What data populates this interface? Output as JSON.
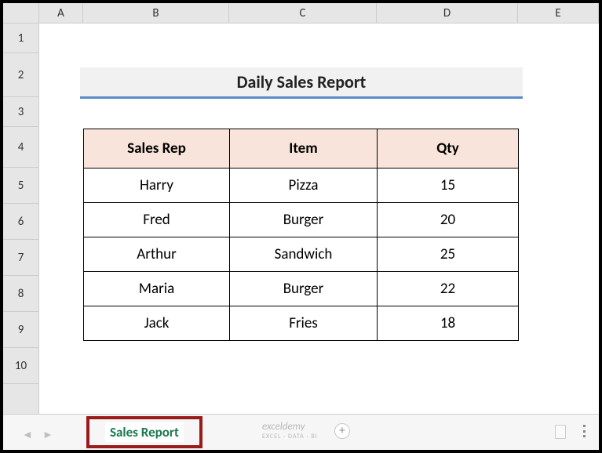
{
  "columns": {
    "A": "A",
    "B": "B",
    "C": "C",
    "D": "D",
    "E": "E"
  },
  "rows": {
    "r1": "1",
    "r2": "2",
    "r3": "3",
    "r4": "4",
    "r5": "5",
    "r6": "6",
    "r7": "7",
    "r8": "8",
    "r9": "9",
    "r10": "10"
  },
  "title": "Daily Sales Report",
  "headers": {
    "rep": "Sales Rep",
    "item": "Item",
    "qty": "Qty"
  },
  "data": [
    {
      "rep": "Harry",
      "item": "Pizza",
      "qty": "15"
    },
    {
      "rep": "Fred",
      "item": "Burger",
      "qty": "20"
    },
    {
      "rep": "Arthur",
      "item": "Sandwich",
      "qty": "25"
    },
    {
      "rep": "Maria",
      "item": "Burger",
      "qty": "22"
    },
    {
      "rep": "Jack",
      "item": "Fries",
      "qty": "18"
    }
  ],
  "tab": {
    "name": "Sales Report"
  },
  "watermark": {
    "main": "exceldemy",
    "sub": "EXCEL · DATA · BI"
  },
  "nav": {
    "prev": "◄",
    "next": "►",
    "add": "+"
  }
}
